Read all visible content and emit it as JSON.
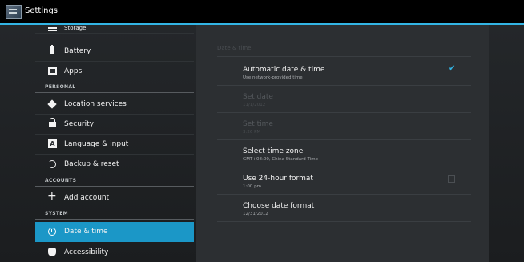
{
  "action_bar": {
    "title": "Settings"
  },
  "sidebar": {
    "items": [
      {
        "label": "Storage",
        "icon": "storage-icon"
      },
      {
        "label": "Battery",
        "icon": "battery-icon"
      },
      {
        "label": "Apps",
        "icon": "apps-icon"
      }
    ],
    "header_personal": "PERSONAL",
    "personal_items": [
      {
        "label": "Location services",
        "icon": "location-icon"
      },
      {
        "label": "Security",
        "icon": "lock-icon"
      },
      {
        "label": "Language & input",
        "icon": "language-icon"
      },
      {
        "label": "Backup & reset",
        "icon": "backup-icon"
      }
    ],
    "header_accounts": "ACCOUNTS",
    "accounts_items": [
      {
        "label": "Add account",
        "icon": "plus-icon"
      }
    ],
    "header_system": "SYSTEM",
    "system_items": [
      {
        "label": "Date & time",
        "icon": "clock-icon",
        "selected": true
      },
      {
        "label": "Accessibility",
        "icon": "hand-icon"
      }
    ]
  },
  "detail": {
    "section_title": "Date & time",
    "settings": [
      {
        "title": "Automatic date & time",
        "summary": "Use network-provided time",
        "checked": true,
        "enabled": true
      },
      {
        "title": "Set date",
        "summary": "11/1/2012",
        "enabled": false
      },
      {
        "title": "Set time",
        "summary": "3:26 PM",
        "enabled": false
      },
      {
        "title": "Select time zone",
        "summary": "GMT+08:00, China Standard Time",
        "enabled": true
      },
      {
        "title": "Use 24-hour format",
        "summary": "1:00 pm",
        "checked": false,
        "enabled": true
      },
      {
        "title": "Choose date format",
        "summary": "12/31/2012",
        "enabled": true
      }
    ]
  },
  "colors": {
    "accent": "#33b5e5",
    "selected_row": "#1b97c7",
    "background": "#24272a"
  }
}
